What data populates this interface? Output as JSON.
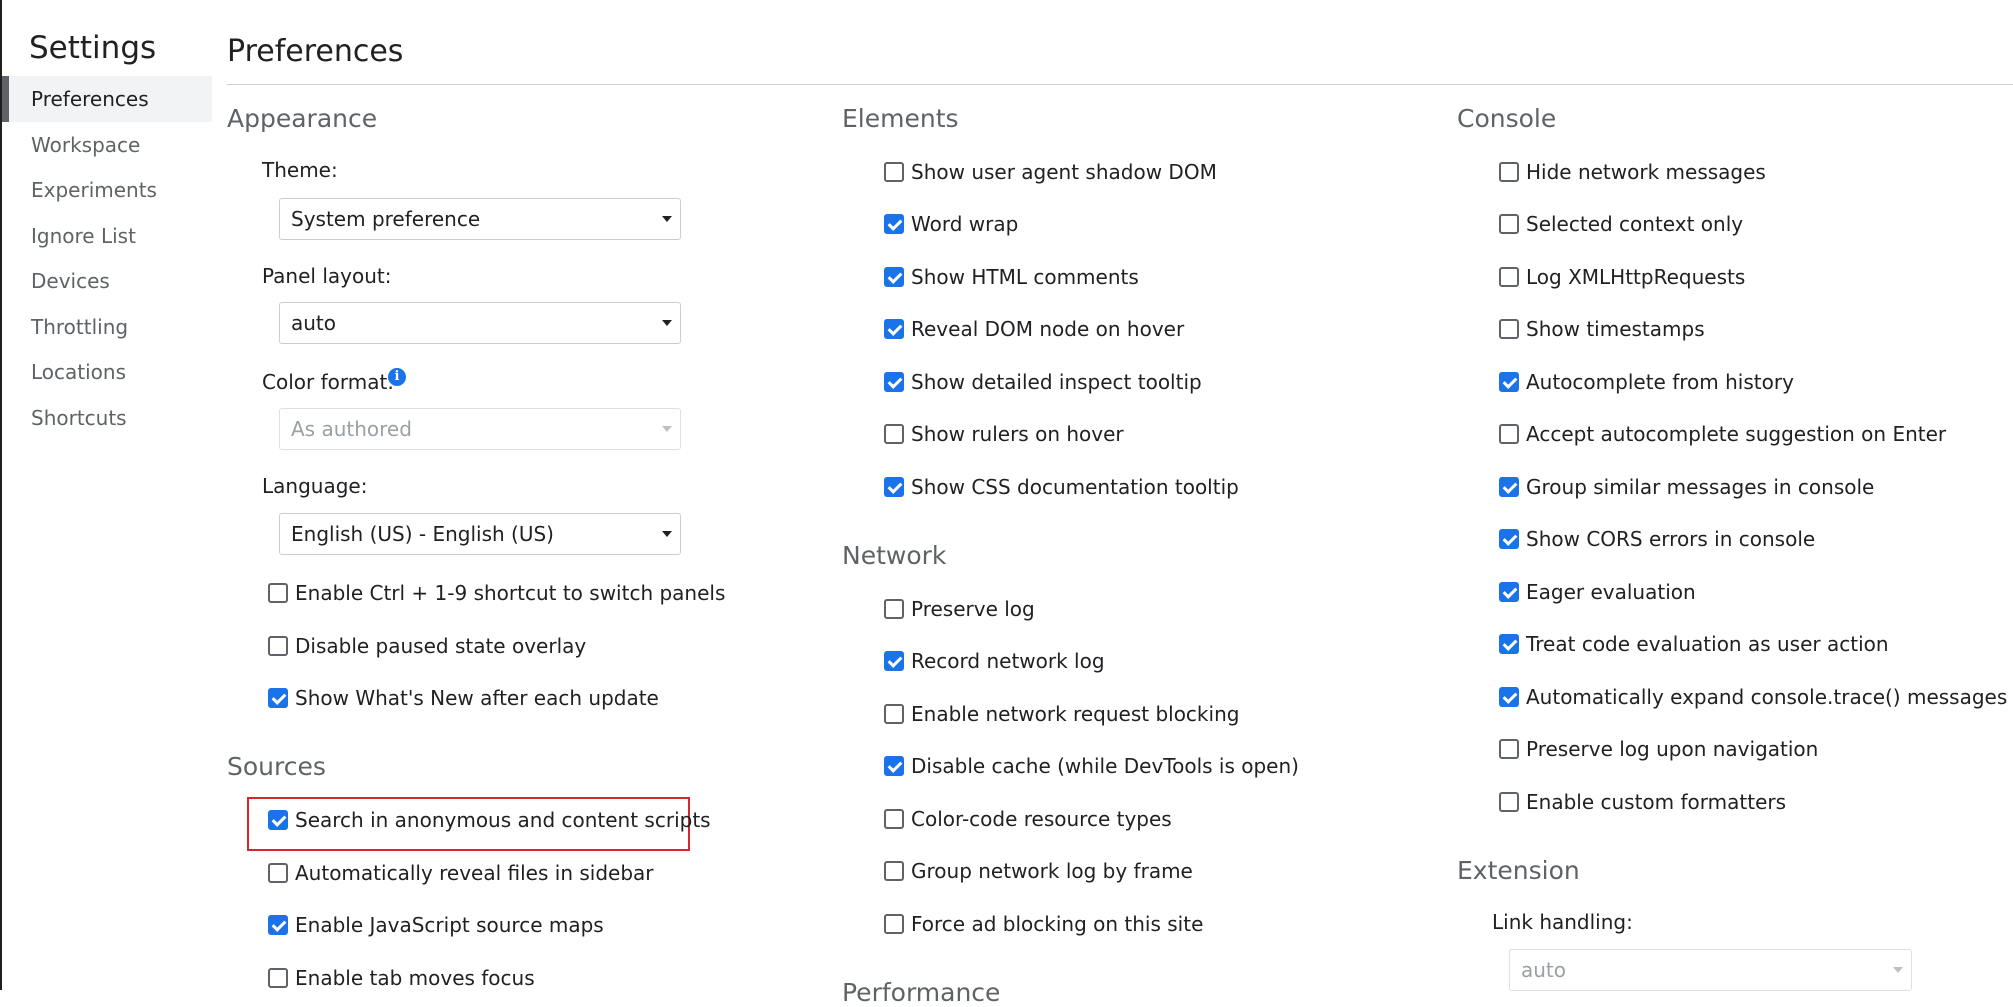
{
  "sidebar": {
    "title": "Settings",
    "items": [
      {
        "label": "Preferences",
        "selected": true
      },
      {
        "label": "Workspace"
      },
      {
        "label": "Experiments"
      },
      {
        "label": "Ignore List"
      },
      {
        "label": "Devices"
      },
      {
        "label": "Throttling"
      },
      {
        "label": "Locations"
      },
      {
        "label": "Shortcuts"
      }
    ]
  },
  "page": {
    "title": "Preferences"
  },
  "appearance": {
    "title": "Appearance",
    "theme": {
      "label": "Theme:",
      "value": "System preference"
    },
    "panel_layout": {
      "label": "Panel layout:",
      "value": "auto"
    },
    "color_format": {
      "label": "Color format:",
      "value": "As authored",
      "disabled": true,
      "info_glyph": "i"
    },
    "language": {
      "label": "Language:",
      "value": "English (US) - English (US)"
    },
    "options": [
      {
        "label": "Enable Ctrl + 1-9 shortcut to switch panels",
        "checked": false
      },
      {
        "label": "Disable paused state overlay",
        "checked": false
      },
      {
        "label": "Show What's New after each update",
        "checked": true
      }
    ]
  },
  "sources": {
    "title": "Sources",
    "options": [
      {
        "label": "Search in anonymous and content scripts",
        "checked": true,
        "highlighted": true
      },
      {
        "label": "Automatically reveal files in sidebar",
        "checked": false
      },
      {
        "label": "Enable JavaScript source maps",
        "checked": true
      },
      {
        "label": "Enable tab moves focus",
        "checked": false
      }
    ]
  },
  "elements": {
    "title": "Elements",
    "options": [
      {
        "label": "Show user agent shadow DOM",
        "checked": false
      },
      {
        "label": "Word wrap",
        "checked": true
      },
      {
        "label": "Show HTML comments",
        "checked": true
      },
      {
        "label": "Reveal DOM node on hover",
        "checked": true
      },
      {
        "label": "Show detailed inspect tooltip",
        "checked": true
      },
      {
        "label": "Show rulers on hover",
        "checked": false
      },
      {
        "label": "Show CSS documentation tooltip",
        "checked": true
      }
    ]
  },
  "network": {
    "title": "Network",
    "options": [
      {
        "label": "Preserve log",
        "checked": false
      },
      {
        "label": "Record network log",
        "checked": true
      },
      {
        "label": "Enable network request blocking",
        "checked": false
      },
      {
        "label": "Disable cache (while DevTools is open)",
        "checked": true
      },
      {
        "label": "Color-code resource types",
        "checked": false
      },
      {
        "label": "Group network log by frame",
        "checked": false
      },
      {
        "label": "Force ad blocking on this site",
        "checked": false
      }
    ]
  },
  "performance": {
    "title": "Performance"
  },
  "console": {
    "title": "Console",
    "options": [
      {
        "label": "Hide network messages",
        "checked": false
      },
      {
        "label": "Selected context only",
        "checked": false
      },
      {
        "label": "Log XMLHttpRequests",
        "checked": false
      },
      {
        "label": "Show timestamps",
        "checked": false
      },
      {
        "label": "Autocomplete from history",
        "checked": true
      },
      {
        "label": "Accept autocomplete suggestion on Enter",
        "checked": false
      },
      {
        "label": "Group similar messages in console",
        "checked": true
      },
      {
        "label": "Show CORS errors in console",
        "checked": true
      },
      {
        "label": "Eager evaluation",
        "checked": true
      },
      {
        "label": "Treat code evaluation as user action",
        "checked": true
      },
      {
        "label": "Automatically expand console.trace() messages",
        "checked": true
      },
      {
        "label": "Preserve log upon navigation",
        "checked": false
      },
      {
        "label": "Enable custom formatters",
        "checked": false
      }
    ]
  },
  "extension": {
    "title": "Extension",
    "link_handling": {
      "label": "Link handling:",
      "value": "auto",
      "disabled": true
    }
  },
  "colors": {
    "accent": "#1a73e8",
    "highlight_border": "#d7262e"
  }
}
